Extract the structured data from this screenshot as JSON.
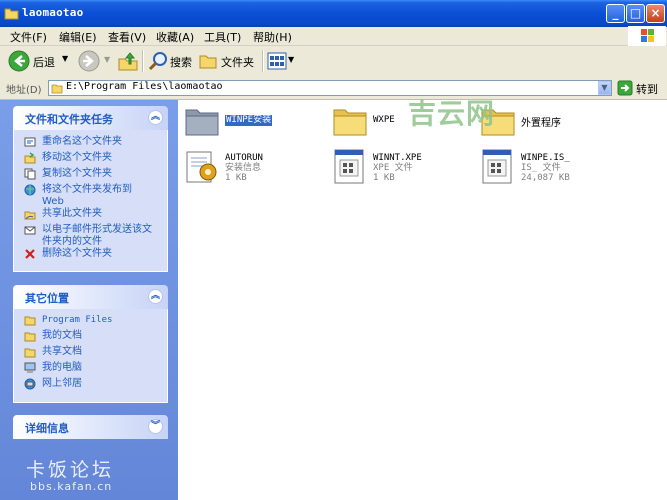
{
  "window": {
    "title": "laomaotao"
  },
  "menubar": {
    "items": [
      "文件(F)",
      "编辑(E)",
      "查看(V)",
      "收藏(A)",
      "工具(T)",
      "帮助(H)"
    ]
  },
  "toolbar": {
    "back_label": "后退",
    "search_label": "搜索",
    "folders_label": "文件夹"
  },
  "address": {
    "label": "地址(D)",
    "value": "E:\\Program Files\\laomaotao",
    "go_label": "转到"
  },
  "file_tasks": {
    "title": "文件和文件夹任务",
    "items": [
      {
        "label": "重命名这个文件夹",
        "icon": "rename-icon"
      },
      {
        "label": "移动这个文件夹",
        "icon": "move-icon"
      },
      {
        "label": "复制这个文件夹",
        "icon": "copy-icon"
      },
      {
        "label": "将这个文件夹发布到 Web",
        "icon": "publish-web-icon"
      },
      {
        "label": "共享此文件夹",
        "icon": "share-icon"
      },
      {
        "label": "以电子邮件形式发送该文件夹内的文件",
        "icon": "email-icon"
      },
      {
        "label": "删除这个文件夹",
        "icon": "delete-icon"
      }
    ]
  },
  "other_places": {
    "title": "其它位置",
    "items": [
      {
        "label": "Program Files",
        "icon": "folder-icon"
      },
      {
        "label": "我的文档",
        "icon": "folder-icon"
      },
      {
        "label": "共享文档",
        "icon": "folder-icon"
      },
      {
        "label": "我的电脑",
        "icon": "computer-icon"
      },
      {
        "label": "网上邻居",
        "icon": "network-icon"
      }
    ]
  },
  "details": {
    "title": "详细信息"
  },
  "files": [
    {
      "name": "WINPE安装",
      "type": "",
      "size": "",
      "icon": "folder-dim-icon",
      "selected": true
    },
    {
      "name": "WXPE",
      "type": "",
      "size": "",
      "icon": "folder-icon",
      "selected": false
    },
    {
      "name": "外置程序",
      "type": "",
      "size": "",
      "icon": "folder-icon",
      "selected": false
    },
    {
      "name": "AUTORUN",
      "type": "安装信息",
      "size": "1 KB",
      "icon": "setup-info-icon",
      "selected": false
    },
    {
      "name": "WINNT.XPE",
      "type": "XPE 文件",
      "size": "1 KB",
      "icon": "file-icon",
      "selected": false
    },
    {
      "name": "WINPE.IS_",
      "type": "IS_ 文件",
      "size": "24,087 KB",
      "icon": "file-icon",
      "selected": false
    }
  ],
  "watermarks": {
    "top": "吉云网",
    "bottom_big": "卡饭论坛",
    "bottom_small": "bbs.kafan.cn"
  },
  "colors": {
    "title_bar": "#0a4fd6",
    "left_pane": "#6486d8",
    "task_text": "#215dc6",
    "selection": "#316ac5"
  }
}
